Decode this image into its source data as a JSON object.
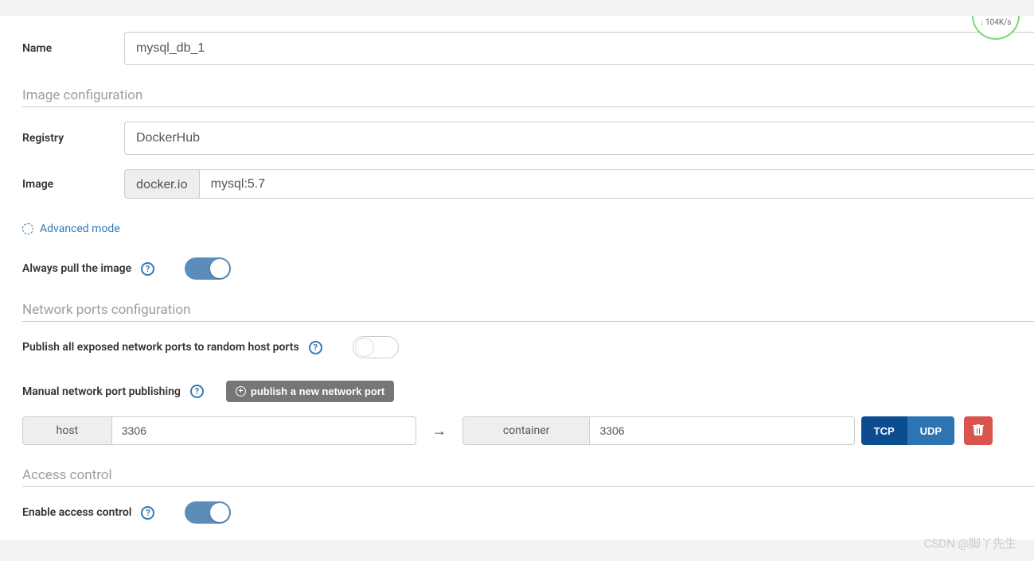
{
  "speed_indicator": "104K/s",
  "form": {
    "name_label": "Name",
    "name_value": "mysql_db_1",
    "image_section_title": "Image configuration",
    "registry_label": "Registry",
    "registry_value": "DockerHub",
    "image_label": "Image",
    "image_prefix": "docker.io",
    "image_value": "mysql:5.7",
    "advanced_mode": "Advanced mode",
    "always_pull_label": "Always pull the image",
    "network_section_title": "Network ports configuration",
    "publish_all_label": "Publish all exposed network ports to random host ports",
    "manual_port_label": "Manual network port publishing",
    "publish_port_button": "publish a new network port",
    "port_row": {
      "host_label": "host",
      "host_value": "3306",
      "container_label": "container",
      "container_value": "3306",
      "tcp": "TCP",
      "udp": "UDP"
    },
    "access_section_title": "Access control",
    "enable_access_label": "Enable access control"
  },
  "watermark": "CSDN @脚丫先生"
}
